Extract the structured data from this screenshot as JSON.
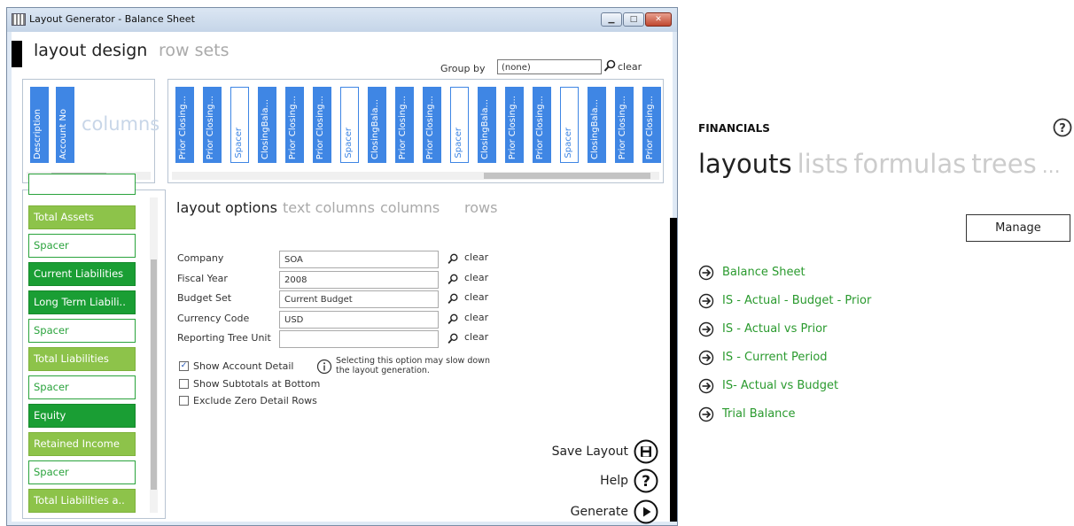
{
  "window": {
    "title": "Layout Generator - Balance Sheet",
    "buttons": {
      "minimize": "▁",
      "maximize": "□",
      "close": "✕"
    }
  },
  "header": {
    "tabs": [
      "layout design",
      "row sets"
    ],
    "group_by_label": "Group by",
    "group_by_value": "(none)",
    "clear_label": "clear"
  },
  "columns_panel": {
    "watermark": "columns",
    "left_columns": [
      {
        "label": "Description",
        "style": "filled"
      },
      {
        "label": "Account No",
        "style": "filled"
      }
    ],
    "right_columns": [
      {
        "label": "Prior Closing...",
        "style": "filled"
      },
      {
        "label": "Prior Closing...",
        "style": "filled"
      },
      {
        "label": "Spacer",
        "style": "outlined"
      },
      {
        "label": "ClosingBala...",
        "style": "filled"
      },
      {
        "label": "Prior Closing...",
        "style": "filled"
      },
      {
        "label": "Prior Closing...",
        "style": "filled"
      },
      {
        "label": "Spacer",
        "style": "outlined"
      },
      {
        "label": "ClosingBala...",
        "style": "filled"
      },
      {
        "label": "Prior Closing...",
        "style": "filled"
      },
      {
        "label": "Prior Closing...",
        "style": "filled"
      },
      {
        "label": "Spacer",
        "style": "outlined"
      },
      {
        "label": "ClosingBala...",
        "style": "filled"
      },
      {
        "label": "Prior Closing...",
        "style": "filled"
      },
      {
        "label": "Prior Closing...",
        "style": "filled"
      },
      {
        "label": "Spacer",
        "style": "outlined"
      },
      {
        "label": "ClosingBala...",
        "style": "filled"
      },
      {
        "label": "Prior Closing...",
        "style": "filled"
      },
      {
        "label": "Prior Closing...",
        "style": "filled"
      }
    ]
  },
  "rows_panel": {
    "rows": [
      {
        "label": "Total Assets",
        "style": "light"
      },
      {
        "label": "Spacer",
        "style": "outline"
      },
      {
        "label": "Current Liabilities",
        "style": "dark"
      },
      {
        "label": "Long Term Liabili..",
        "style": "dark"
      },
      {
        "label": "Spacer",
        "style": "outline"
      },
      {
        "label": "Total Liabilities",
        "style": "light"
      },
      {
        "label": "Spacer",
        "style": "outline"
      },
      {
        "label": "Equity",
        "style": "dark"
      },
      {
        "label": "Retained Income",
        "style": "light"
      },
      {
        "label": "Spacer",
        "style": "outline"
      },
      {
        "label": "Total Liabilities a..",
        "style": "light"
      }
    ]
  },
  "options": {
    "tabs": [
      "layout options",
      "text columns",
      "columns",
      "rows"
    ],
    "fields": [
      {
        "label": "Company",
        "value": "SOA"
      },
      {
        "label": "Fiscal Year",
        "value": "2008"
      },
      {
        "label": "Budget Set",
        "value": "Current Budget"
      },
      {
        "label": "Currency Code",
        "value": "USD"
      },
      {
        "label": "Reporting Tree Unit",
        "value": ""
      }
    ],
    "clear_label": "clear",
    "checkboxes": [
      {
        "label": "Show Account Detail",
        "checked": true
      },
      {
        "label": "Show Subtotals at Bottom",
        "checked": false
      },
      {
        "label": "Exclude Zero Detail Rows",
        "checked": false
      }
    ],
    "info_note": "Selecting this option may slow down the layout generation."
  },
  "actions": {
    "save": "Save Layout",
    "help": "Help",
    "generate": "Generate"
  },
  "financials": {
    "title": "FINANCIALS",
    "tabs": [
      "layouts",
      "lists",
      "formulas",
      "trees",
      "..."
    ],
    "manage_label": "Manage",
    "items": [
      "Balance Sheet",
      "IS - Actual - Budget - Prior",
      "IS - Actual vs Prior",
      "IS - Current Period",
      "IS- Actual vs Budget",
      "Trial Balance"
    ]
  },
  "colors": {
    "accent_blue": "#3f86e4",
    "green_light": "#8dc34a",
    "green_dark": "#1a9e34",
    "link_green": "#2a9a2e"
  }
}
